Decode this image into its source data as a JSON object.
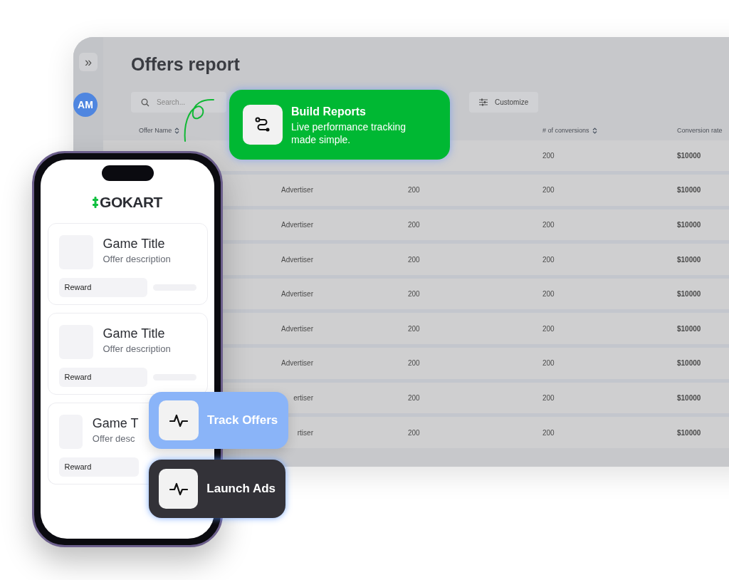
{
  "dashboard": {
    "sidebar": {
      "expand_button": "»",
      "avatar": "AM"
    },
    "title": "Offers report",
    "search": {
      "placeholder": "Search..."
    },
    "customize_button": "Customize",
    "table": {
      "headers": {
        "offer_name": "Offer Name",
        "conversions": "# of conversions",
        "conversion_rate": "Conversion rate"
      },
      "rows": [
        {
          "conversions": "200",
          "conversion_rate": "$10000"
        },
        {
          "column_2": "Advertiser",
          "column_3": "200",
          "conversions": "200",
          "conversion_rate": "$10000"
        },
        {
          "column_2": "Advertiser",
          "column_3": "200",
          "conversions": "200",
          "conversion_rate": "$10000"
        },
        {
          "column_2": "Advertiser",
          "column_3": "200",
          "conversions": "200",
          "conversion_rate": "$10000"
        },
        {
          "column_2": "Advertiser",
          "column_3": "200",
          "conversions": "200",
          "conversion_rate": "$10000"
        },
        {
          "column_2": "Advertiser",
          "column_3": "200",
          "conversions": "200",
          "conversion_rate": "$10000"
        },
        {
          "column_2": "Advertiser",
          "column_3": "200",
          "conversions": "200",
          "conversion_rate": "$10000"
        },
        {
          "column_2": "ertiser",
          "column_3": "200",
          "conversions": "200",
          "conversion_rate": "$10000"
        },
        {
          "column_2": "rtiser",
          "column_3": "200",
          "conversions": "200",
          "conversion_rate": "$10000"
        }
      ]
    }
  },
  "phone": {
    "logo": "GOKART",
    "offers": [
      {
        "title": "Game Title",
        "description": "Offer description",
        "reward": "Reward"
      },
      {
        "title": "Game Title",
        "description": "Offer description",
        "reward": "Reward"
      },
      {
        "title": "Game T",
        "description": "Offer desc",
        "reward": "Reward"
      }
    ]
  },
  "feature_cards": [
    {
      "kind": "detailed",
      "title": "Build Reports",
      "subtitle": "Live performance tracking made simple."
    },
    {
      "kind": "light",
      "title": "Track Offers"
    },
    {
      "kind": "dark",
      "title": "Launch Ads"
    }
  ]
}
